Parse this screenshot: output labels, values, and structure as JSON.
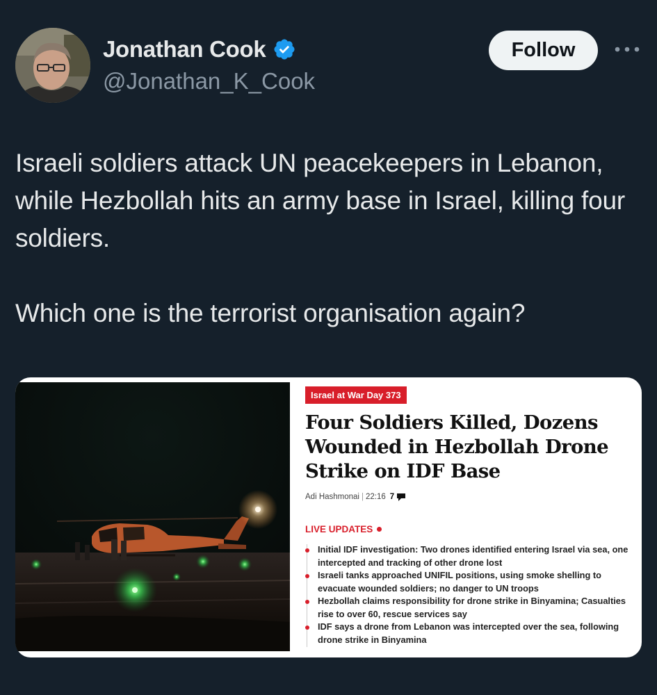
{
  "tweet": {
    "author": {
      "display_name": "Jonathan Cook",
      "handle": "@Jonathan_K_Cook",
      "verified": true,
      "verified_color": "#1d9bf0"
    },
    "follow_label": "Follow",
    "text_paragraphs": [
      "Israeli soldiers attack UN peacekeepers in Lebanon, while Hezbollah hits an army base in Israel, killing four soldiers.",
      "Which one is the terrorist organisation again?"
    ]
  },
  "media": {
    "article": {
      "section_badge": "Israel at War Day 373",
      "headline": "Four Soldiers Killed, Dozens Wounded in Hezbollah Drone Strike on IDF Base",
      "author": "Adi Hashmonai",
      "time": "22:16",
      "comment_count": "7",
      "live_label": "LIVE UPDATES",
      "updates": [
        "Initial IDF investigation: Two drones identified entering Israel via sea, one intercepted and tracking of other drone lost",
        "Israeli tanks approached UNIFIL positions, using smoke shelling to evacuate wounded soldiers; no danger to UN troops",
        "Hezbollah claims responsibility for drone strike in Binyamina; Casualties rise to over 60, rescue services say",
        "IDF says a drone from Lebanon was intercepted over the sea, following drone strike in Binyamina"
      ]
    }
  },
  "colors": {
    "background": "#15202b",
    "text_primary": "#e7e9ea",
    "text_secondary": "#8b98a5",
    "accent_red": "#d81e2a"
  },
  "icons": [
    "verified-badge-icon",
    "more-options-icon",
    "comment-icon"
  ]
}
